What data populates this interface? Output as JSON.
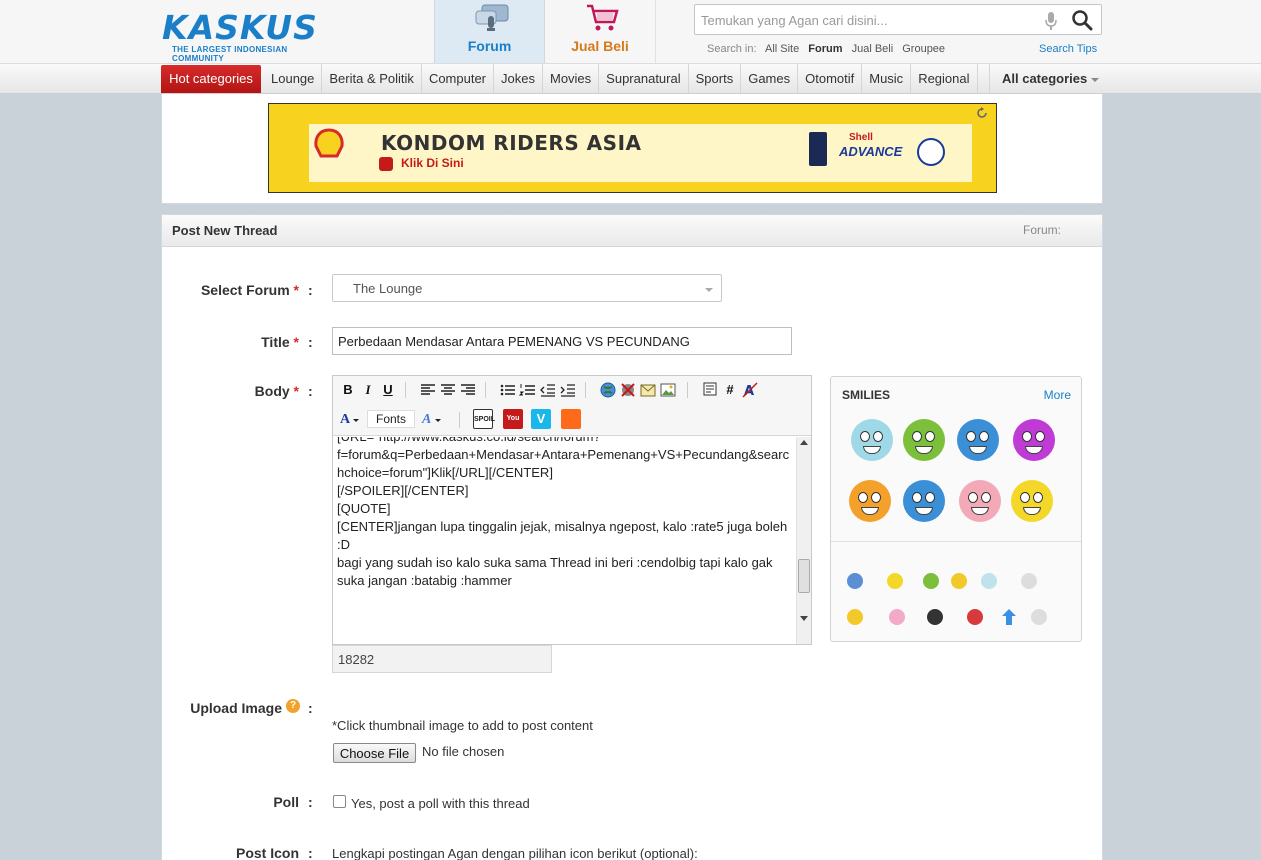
{
  "logo": {
    "brand": "KASKUS",
    "tagline": "THE LARGEST INDONESIAN COMMUNITY"
  },
  "nav_tabs": [
    {
      "label": "Forum",
      "icon": "microphone-chat-icon",
      "active": true
    },
    {
      "label": "Jual Beli",
      "icon": "shopping-cart-icon",
      "active": false
    }
  ],
  "search": {
    "placeholder": "Temukan yang Agan cari disini...",
    "scope_label": "Search in:",
    "scopes": [
      "All Site",
      "Forum",
      "Jual Beli",
      "Groupee"
    ],
    "active_scope": "Forum",
    "tips_link": "Search Tips"
  },
  "categories": {
    "hot": "Hot categories",
    "items": [
      "Lounge",
      "Berita & Politik",
      "Computer",
      "Jokes",
      "Movies",
      "Supranatural",
      "Sports",
      "Games",
      "Otomotif",
      "Music",
      "Regional"
    ],
    "all": "All categories"
  },
  "ad": {
    "title": "KONDOM RIDERS ASIA",
    "cta": "Klik Di Sini",
    "brand_top": "Shell",
    "brand": "ADVANCE"
  },
  "post": {
    "header_title": "Post New Thread",
    "forum_label": "Forum:",
    "labels": {
      "select_forum": "Select Forum",
      "title": "Title",
      "body": "Body",
      "upload_image": "Upload Image",
      "poll": "Poll",
      "post_icon": "Post Icon"
    },
    "required_mark": "*",
    "colon": ":",
    "selected_forum": "The Lounge",
    "title_value": "Perbedaan Mendasar Antara PEMENANG VS PECUNDANG",
    "editor": {
      "fonts_label": "Fonts",
      "body_lines": [
        "[URL=\"http://www.kaskus.co.id/search/forum?",
        "f=forum&q=Perbedaan+Mendasar+Antara+Pemenang+VS+Pecundang&searc",
        "hchoice=forum\"]Klik[/URL][/CENTER]",
        "",
        "[/SPOILER][/CENTER]",
        "",
        "",
        "[QUOTE]",
        "[CENTER]jangan lupa tinggalin jejak, misalnya ngepost, kalo :rate5 juga boleh",
        ":D",
        "bagi yang sudah iso kalo suka sama Thread ini beri :cendolbig tapi kalo gak",
        "suka jangan :batabig :hammer"
      ]
    },
    "char_count": "18282",
    "smilies": {
      "title": "SMILIES",
      "more": "More"
    },
    "upload_note": "*Click thumbnail image to add to post content",
    "choose_file": "Choose File",
    "no_file": "No file chosen",
    "poll_label": "Yes, post a poll with this thread",
    "post_icon_note": "Lengkapi postingan Agan dengan pilihan icon berikut (optional):"
  },
  "colors": {
    "brand_blue": "#1a7fc8",
    "brand_orange": "#f39a1d",
    "hot_red": "#c41a1a",
    "required_red": "#d62b2b"
  }
}
